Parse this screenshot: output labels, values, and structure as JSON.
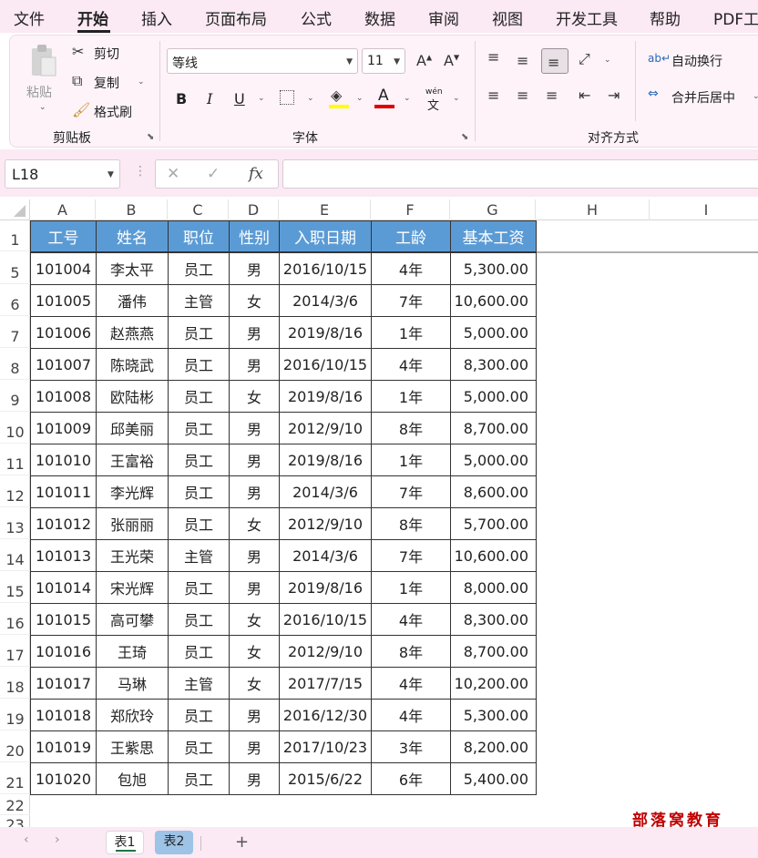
{
  "menu": [
    "文件",
    "开始",
    "插入",
    "页面布局",
    "公式",
    "数据",
    "审阅",
    "视图",
    "开发工具",
    "帮助",
    "PDF工"
  ],
  "ribbon": {
    "paste": "粘贴",
    "cut": "剪切",
    "copy": "复制",
    "format_painter": "格式刷",
    "group_clipboard": "剪贴板",
    "font_name": "等线",
    "font_size": "11",
    "bold": "B",
    "italic": "I",
    "underline": "U",
    "phonetic_top": "wén",
    "phonetic_bottom": "文",
    "group_font": "字体",
    "wrap_text": "自动换行",
    "merge_center": "合并后居中",
    "group_alignment": "对齐方式"
  },
  "formula_bar": {
    "name_box": "L18",
    "fx": "fx",
    "formula": ""
  },
  "columns": [
    "A",
    "B",
    "C",
    "D",
    "E",
    "F",
    "G",
    "H",
    "I"
  ],
  "row_numbers": [
    "1",
    "5",
    "6",
    "7",
    "8",
    "9",
    "10",
    "11",
    "12",
    "13",
    "14",
    "15",
    "16",
    "17",
    "18",
    "19",
    "20",
    "21",
    "22",
    "23"
  ],
  "table": {
    "headers": [
      "工号",
      "姓名",
      "职位",
      "性别",
      "入职日期",
      "工龄",
      "基本工资"
    ],
    "rows": [
      [
        "101004",
        "李太平",
        "员工",
        "男",
        "2016/10/15",
        "4年",
        "5,300.00"
      ],
      [
        "101005",
        "潘伟",
        "主管",
        "女",
        "2014/3/6",
        "7年",
        "10,600.00"
      ],
      [
        "101006",
        "赵燕燕",
        "员工",
        "男",
        "2019/8/16",
        "1年",
        "5,000.00"
      ],
      [
        "101007",
        "陈晓武",
        "员工",
        "男",
        "2016/10/15",
        "4年",
        "8,300.00"
      ],
      [
        "101008",
        "欧陆彬",
        "员工",
        "女",
        "2019/8/16",
        "1年",
        "5,000.00"
      ],
      [
        "101009",
        "邱美丽",
        "员工",
        "男",
        "2012/9/10",
        "8年",
        "8,700.00"
      ],
      [
        "101010",
        "王富裕",
        "员工",
        "男",
        "2019/8/16",
        "1年",
        "5,000.00"
      ],
      [
        "101011",
        "李光辉",
        "员工",
        "男",
        "2014/3/6",
        "7年",
        "8,600.00"
      ],
      [
        "101012",
        "张丽丽",
        "员工",
        "女",
        "2012/9/10",
        "8年",
        "5,700.00"
      ],
      [
        "101013",
        "王光荣",
        "主管",
        "男",
        "2014/3/6",
        "7年",
        "10,600.00"
      ],
      [
        "101014",
        "宋光辉",
        "员工",
        "男",
        "2019/8/16",
        "1年",
        "8,000.00"
      ],
      [
        "101015",
        "高可攀",
        "员工",
        "女",
        "2016/10/15",
        "4年",
        "8,300.00"
      ],
      [
        "101016",
        "王琦",
        "员工",
        "女",
        "2012/9/10",
        "8年",
        "8,700.00"
      ],
      [
        "101017",
        "马琳",
        "主管",
        "女",
        "2017/7/15",
        "4年",
        "10,200.00"
      ],
      [
        "101018",
        "郑欣玲",
        "员工",
        "男",
        "2016/12/30",
        "4年",
        "5,300.00"
      ],
      [
        "101019",
        "王紫思",
        "员工",
        "男",
        "2017/10/23",
        "3年",
        "8,200.00"
      ],
      [
        "101020",
        "包旭",
        "员工",
        "男",
        "2015/6/22",
        "6年",
        "5,400.00"
      ]
    ]
  },
  "watermark": "部落窝教育",
  "sheet_tabs": [
    "表1",
    "表2"
  ],
  "add_sheet": "+",
  "colors": {
    "header_fill": "#5b9bd5",
    "header_text": "#ffffff",
    "ribbon_bg": "#fdf3f9",
    "watermark": "#c00000",
    "font_color_bar": "#e00000",
    "fill_color_bar": "#ffff00"
  }
}
